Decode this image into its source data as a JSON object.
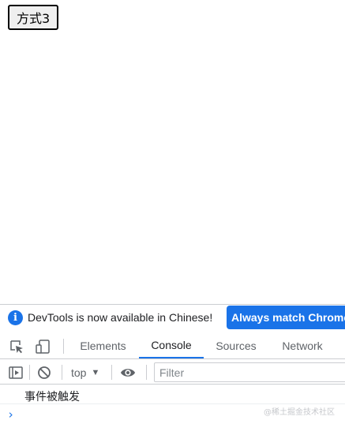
{
  "page": {
    "button_label": "方式3"
  },
  "devtools": {
    "infobar": {
      "message": "DevTools is now available in Chinese!",
      "action_label": "Always match Chrome"
    },
    "tabs": [
      {
        "label": "Elements",
        "active": false
      },
      {
        "label": "Console",
        "active": true
      },
      {
        "label": "Sources",
        "active": false
      },
      {
        "label": "Network",
        "active": false
      }
    ],
    "console_toolbar": {
      "context": "top",
      "filter_placeholder": "Filter"
    },
    "console_log": [
      {
        "text": "事件被触发"
      }
    ],
    "watermark": "@稀土掘金技术社区"
  },
  "colors": {
    "accent": "#1a73e8",
    "border": "#cbcdd1",
    "text_secondary": "#5f6368"
  },
  "icons": [
    "info-icon",
    "inspect-element-icon",
    "device-toolbar-icon",
    "sidebar-toggle-icon",
    "clear-console-icon",
    "eye-icon",
    "chevron-right-icon"
  ]
}
